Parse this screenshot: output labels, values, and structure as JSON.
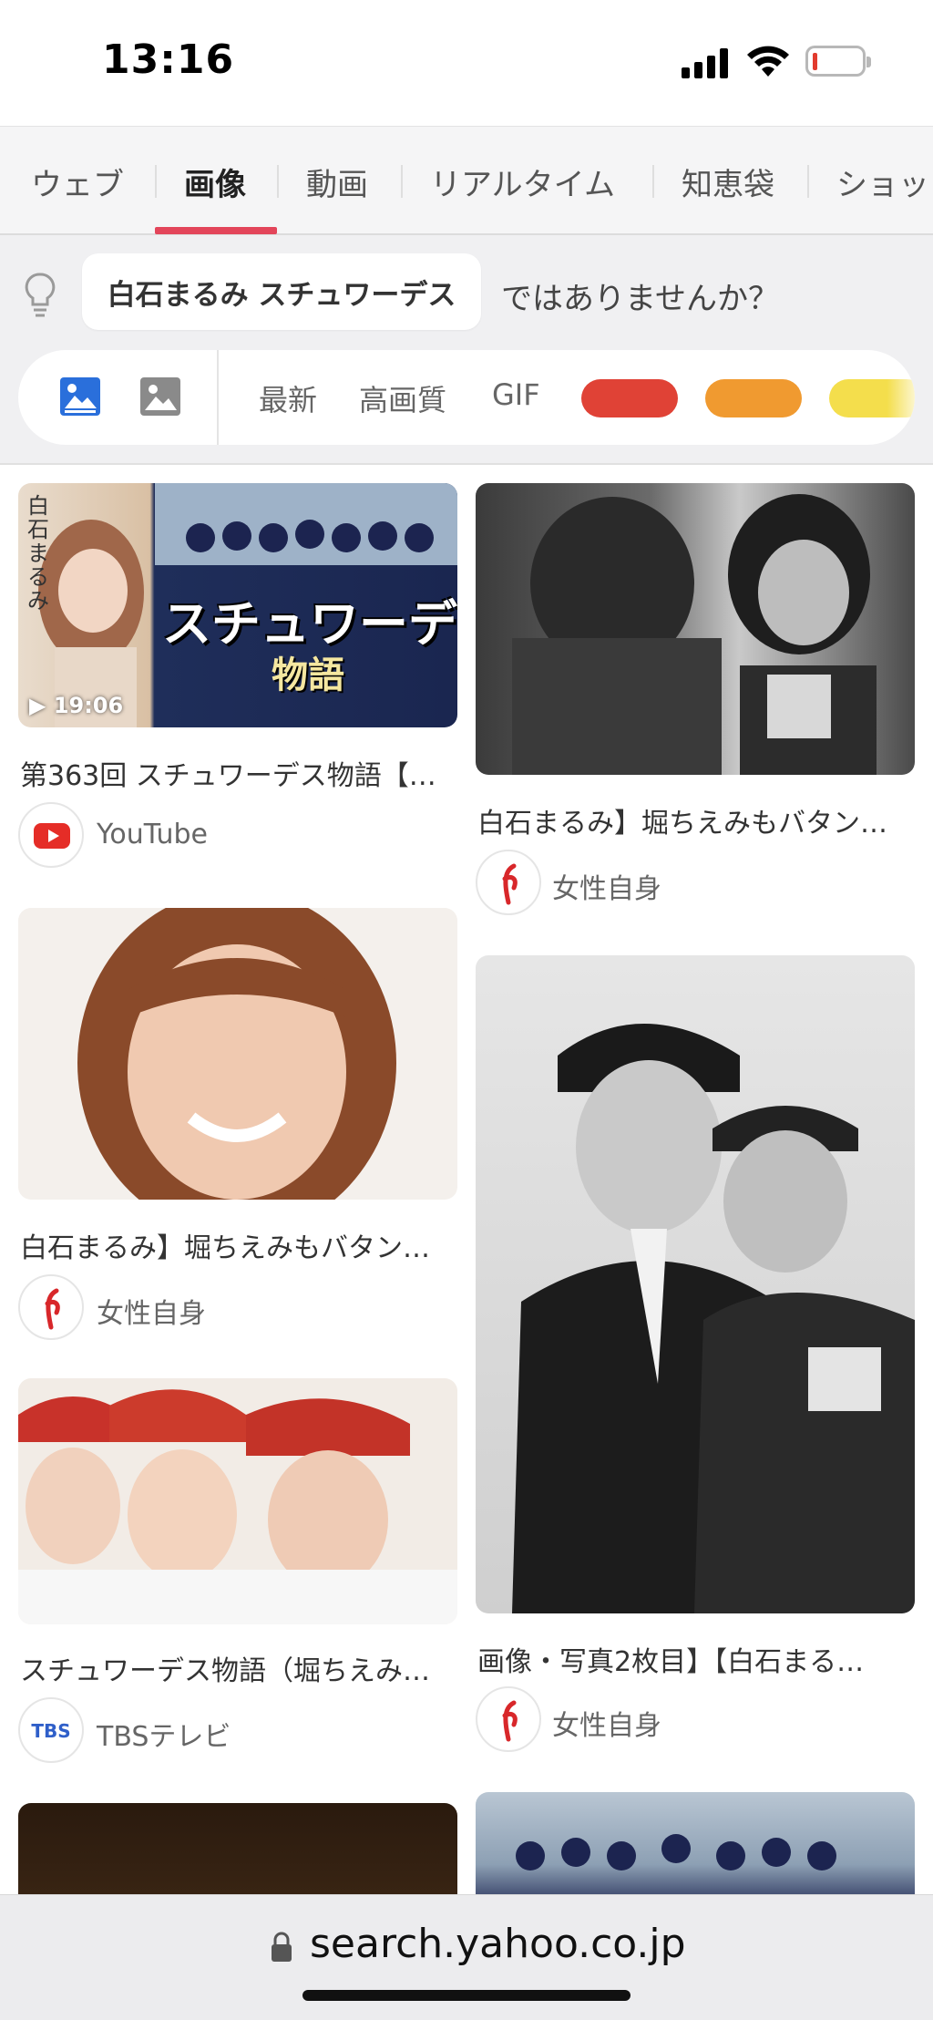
{
  "status_bar": {
    "time": "13:16"
  },
  "tabs": [
    {
      "label": "ウェブ",
      "active": false
    },
    {
      "label": "画像",
      "active": true
    },
    {
      "label": "動画",
      "active": false
    },
    {
      "label": "リアルタイム",
      "active": false
    },
    {
      "label": "知恵袋",
      "active": false
    },
    {
      "label": "ショッ",
      "active": false
    }
  ],
  "suggestion": {
    "query": "白石まるみ スチュワーデス",
    "tail": "ではありませんか？"
  },
  "filters": {
    "labels": [
      "最新",
      "高画質",
      "GIF"
    ],
    "colors": [
      "#e04236",
      "#f09a30",
      "#f4de4c"
    ]
  },
  "results": [
    {
      "caption": "第363回 スチュワーデス物語【…",
      "source": "YouTube",
      "source_logo": "youtube-logo",
      "duration": "▶ 19:06",
      "banner_text": "スチュワーデス",
      "banner_sub": "物語",
      "side_text": "白石まるみ"
    },
    {
      "caption": "白石まるみ】堀ちえみもバタン…",
      "source": "女性自身",
      "source_logo": "jisin-logo"
    },
    {
      "caption": "白石まるみ】堀ちえみもバタン…",
      "source": "女性自身",
      "source_logo": "jisin-logo"
    },
    {
      "caption": "画像・写真2枚目】【白石まる…",
      "source": "女性自身",
      "source_logo": "jisin-logo"
    },
    {
      "caption": "スチュワーデス物語（堀ちえみ…",
      "source": "TBSテレビ",
      "source_logo": "tbs-logo",
      "logo_text": "TBS"
    }
  ],
  "url_bar": {
    "url": "search.yahoo.co.jp"
  }
}
